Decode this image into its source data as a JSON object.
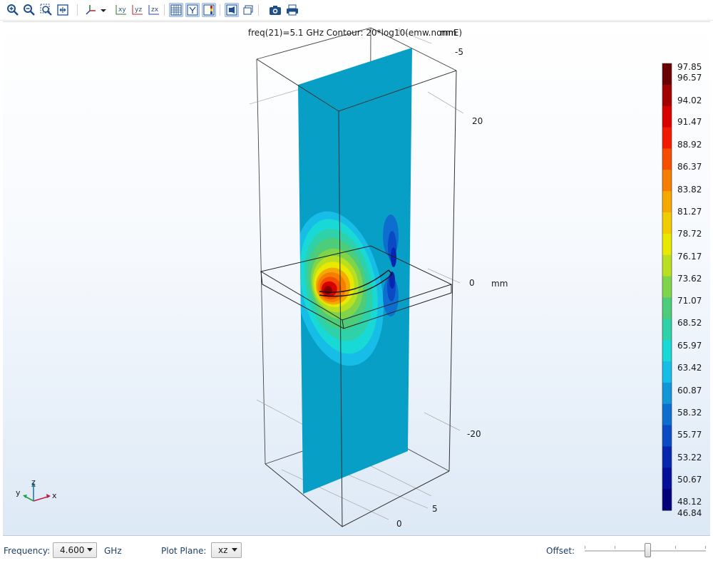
{
  "toolbar": {
    "icons": [
      "zoom-in-icon",
      "zoom-out-icon",
      "zoom-box-icon",
      "zoom-extents-icon",
      "axis-orientation-icon",
      "view-xy-icon",
      "view-yz-icon",
      "view-zx-icon",
      "show-grid-icon",
      "show-axis-icon",
      "show-legends-icon",
      "headlight-icon",
      "render-wireframe-icon",
      "camera-icon",
      "print-icon"
    ],
    "view_xy": "xy",
    "view_yz": "yz",
    "view_zx": "zx"
  },
  "plot": {
    "title": "freq(21)=5.1 GHz   Contour: 20*log10(emw.normE)",
    "axis_unit": "mm",
    "labels": {
      "z_minus5": "-5",
      "z_20": "20",
      "z_0": "0",
      "z_unit": "mm",
      "z_minus20": "-20",
      "x_5": "5",
      "x_0": "0",
      "top_mm": "mm",
      "top_5": "5"
    },
    "triad": {
      "x": "x",
      "y": "y",
      "z": "z"
    },
    "plane_color": "#089fc7"
  },
  "colorbar": {
    "colors": [
      "#6b0000",
      "#a30000",
      "#d90000",
      "#f21a00",
      "#f54e00",
      "#f57e00",
      "#f5a800",
      "#f0cc00",
      "#e8e800",
      "#b8e020",
      "#7fd44a",
      "#4dcc7a",
      "#2ed1a8",
      "#19d9d6",
      "#16bde6",
      "#1296d6",
      "#0e6ed0",
      "#0a4ac4",
      "#0626b0",
      "#05109a",
      "#03007a"
    ],
    "labels": [
      "97.85",
      "96.57",
      "94.02",
      "91.47",
      "88.92",
      "86.37",
      "83.82",
      "81.27",
      "78.72",
      "76.17",
      "73.62",
      "71.07",
      "68.52",
      "65.97",
      "63.42",
      "60.87",
      "58.32",
      "55.77",
      "53.22",
      "50.67",
      "48.12",
      "46.84"
    ]
  },
  "bottom": {
    "frequency_label": "Frequency:",
    "frequency_value": "4.600",
    "frequency_unit": "GHz",
    "plane_label": "Plot Plane:",
    "plane_value": "xz",
    "offset_label": "Offset:",
    "offset_fraction": 0.52
  }
}
